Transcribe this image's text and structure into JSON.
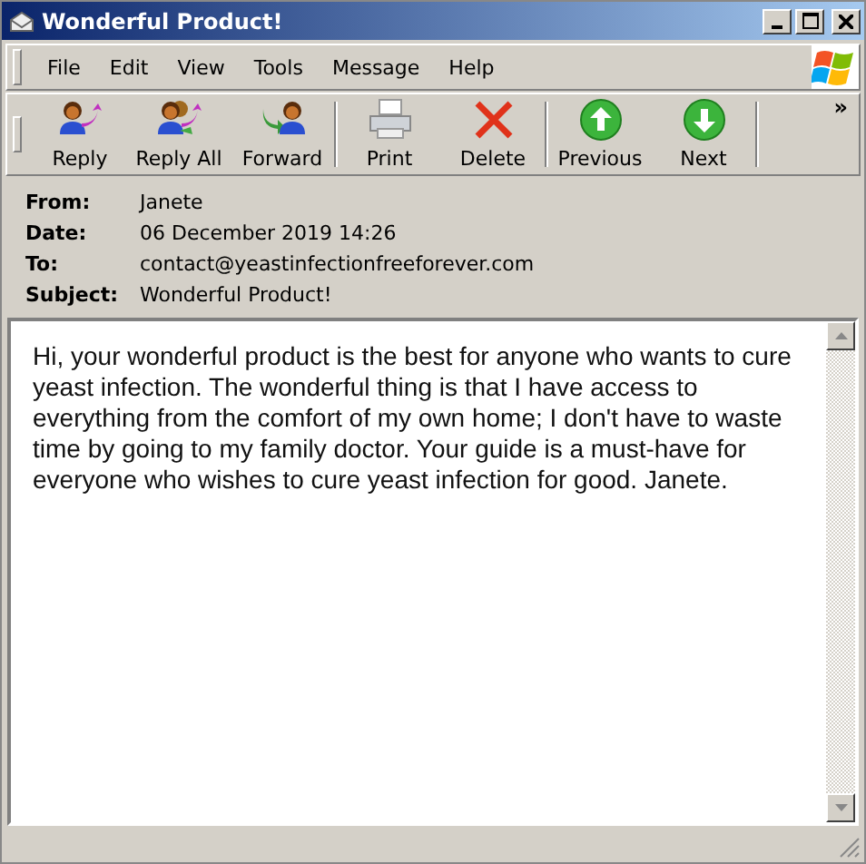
{
  "window": {
    "title": "Wonderful Product!"
  },
  "menu": [
    "File",
    "Edit",
    "View",
    "Tools",
    "Message",
    "Help"
  ],
  "toolbar": {
    "groups": [
      [
        {
          "label": "Reply",
          "kind": "reply"
        },
        {
          "label": "Reply All",
          "kind": "replyall"
        },
        {
          "label": "Forward",
          "kind": "forward"
        }
      ],
      [
        {
          "label": "Print",
          "kind": "print"
        },
        {
          "label": "Delete",
          "kind": "delete"
        }
      ],
      [
        {
          "label": "Previous",
          "kind": "up"
        },
        {
          "label": "Next",
          "kind": "down"
        }
      ]
    ],
    "overflow": "»"
  },
  "headers": [
    {
      "label": "From:",
      "value": "Janete"
    },
    {
      "label": "Date:",
      "value": "06 December 2019 14:26"
    },
    {
      "label": "To:",
      "value": "contact@yeastinfectionfreeforever.com"
    },
    {
      "label": "Subject:",
      "value": "Wonderful Product!"
    }
  ],
  "body": "Hi, your wonderful product is the best for anyone who wants to cure yeast infection. The wonderful thing is that I have access to everything from the comfort of my own home; I don't have to waste time by going to my family doctor. Your guide is a must-have for everyone who wishes to cure yeast infection for good. Janete."
}
